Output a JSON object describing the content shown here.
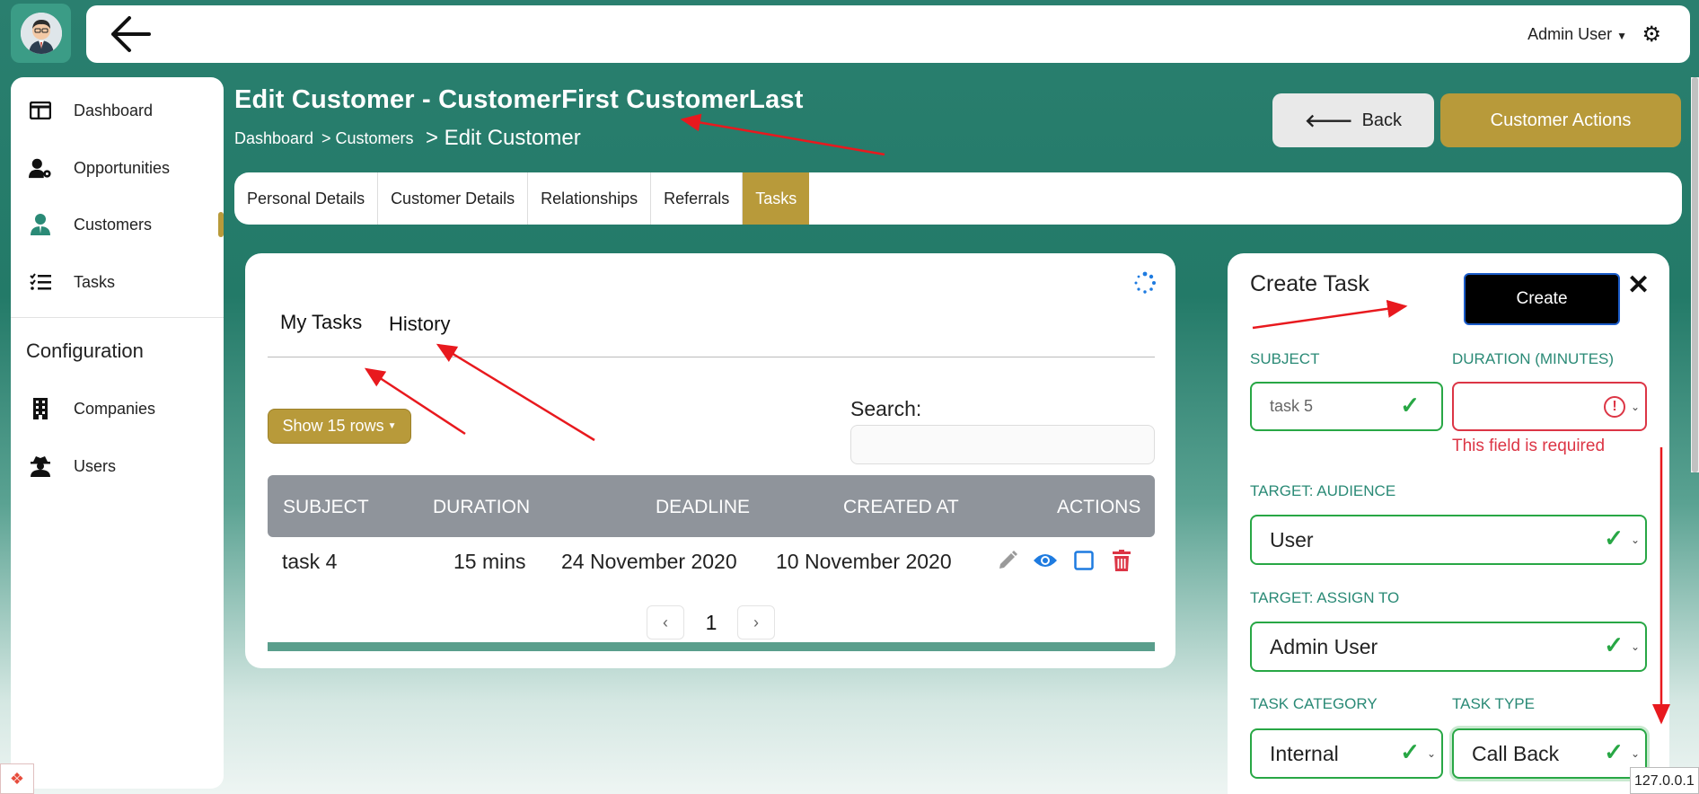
{
  "header": {
    "user_menu": "Admin User"
  },
  "sidebar": {
    "items": [
      {
        "label": "Dashboard",
        "icon": "dashboard-icon"
      },
      {
        "label": "Opportunities",
        "icon": "user-cog-icon"
      },
      {
        "label": "Customers",
        "icon": "user-tie-icon"
      },
      {
        "label": "Tasks",
        "icon": "task-list-icon"
      }
    ],
    "section_title": "Configuration",
    "config_items": [
      {
        "label": "Companies",
        "icon": "building-icon"
      },
      {
        "label": "Users",
        "icon": "user-secret-icon"
      }
    ]
  },
  "page": {
    "title": "Edit Customer - CustomerFirst CustomerLast",
    "breadcrumb": [
      "Dashboard",
      "> Customers",
      "> Edit Customer"
    ],
    "back_label": "Back",
    "actions_label": "Customer Actions"
  },
  "tabs": [
    "Personal Details",
    "Customer Details",
    "Relationships",
    "Referrals",
    "Tasks"
  ],
  "tasks_card": {
    "subtabs": [
      "My Tasks",
      "History"
    ],
    "show_rows": "Show 15 rows",
    "search_label": "Search:",
    "columns": [
      "SUBJECT",
      "DURATION",
      "DEADLINE",
      "CREATED AT",
      "ACTIONS"
    ],
    "rows": [
      {
        "subject": "task 4",
        "duration": "15 mins",
        "deadline": "24 November 2020",
        "created_at": "10 November 2020"
      }
    ],
    "page": "1"
  },
  "create_task": {
    "title": "Create Task",
    "create_label": "Create",
    "subject_label": "SUBJECT",
    "subject_value": "task 5",
    "duration_label": "DURATION (MINUTES)",
    "duration_error": "This field is required",
    "audience_label": "TARGET: AUDIENCE",
    "audience_value": "User",
    "assign_label": "TARGET: ASSIGN TO",
    "assign_value": "Admin User",
    "category_label": "TASK CATEGORY",
    "category_value": "Internal",
    "type_label": "TASK TYPE",
    "type_value": "Call Back"
  },
  "footer": {
    "ip": "127.0.0.1"
  },
  "colors": {
    "brand_green": "#2a7f6f",
    "gold": "#b89a3a",
    "valid": "#28a745",
    "error": "#dc3545",
    "annotation_arrow": "#e8191e"
  }
}
